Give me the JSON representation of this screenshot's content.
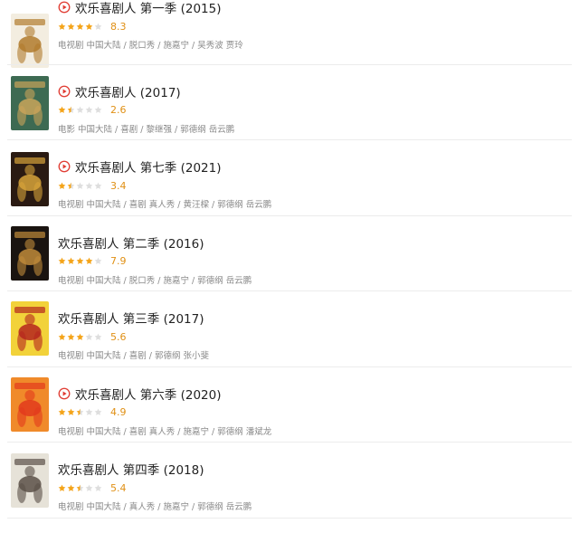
{
  "colors": {
    "star_full": "#f4a41a",
    "star_empty": "#dedede",
    "score": "#e09015",
    "play": "#e03a31",
    "title": "#222222",
    "meta": "#8a8a8a"
  },
  "items": [
    {
      "title": "欢乐喜剧人 第一季 (2015)",
      "has_play": true,
      "rating": 8.3,
      "rating_text": "8.3",
      "meta": "电视剧 中国大陆 / 脱口秀 / 施嘉宁 / 吴秀波 贾玲",
      "poster_icon": "show-poster-season1",
      "poster_colors": [
        "#f3ede0",
        "#b07a2c"
      ]
    },
    {
      "title": "欢乐喜剧人 (2017)",
      "has_play": true,
      "rating": 2.6,
      "rating_text": "2.6",
      "meta": "电影 中国大陆 / 喜剧 / 黎继强 / 郭德纲 岳云鹏",
      "poster_icon": "movie-poster-2017",
      "poster_colors": [
        "#3d6a52",
        "#c9a45a"
      ]
    },
    {
      "title": "欢乐喜剧人 第七季 (2021)",
      "has_play": true,
      "rating": 3.4,
      "rating_text": "3.4",
      "meta": "电视剧 中国大陆 / 喜剧 真人秀 / 黄汪樑 / 郭德纲 岳云鹏",
      "poster_icon": "show-poster-season7",
      "poster_colors": [
        "#2a1a12",
        "#d7a43b"
      ]
    },
    {
      "title": "欢乐喜剧人 第二季 (2016)",
      "has_play": false,
      "rating": 7.9,
      "rating_text": "7.9",
      "meta": "电视剧 中国大陆 / 脱口秀 / 施嘉宁 / 郭德纲 岳云鹏",
      "poster_icon": "show-poster-season2",
      "poster_colors": [
        "#1a1410",
        "#c08a3a"
      ]
    },
    {
      "title": "欢乐喜剧人 第三季 (2017)",
      "has_play": false,
      "rating": 5.6,
      "rating_text": "5.6",
      "meta": "电视剧 中国大陆 / 喜剧 / 郭德纲 张小斐",
      "poster_icon": "show-poster-season3",
      "poster_colors": [
        "#f2d23a",
        "#b5261e"
      ]
    },
    {
      "title": "欢乐喜剧人 第六季 (2020)",
      "has_play": true,
      "rating": 4.9,
      "rating_text": "4.9",
      "meta": "电视剧 中国大陆 / 喜剧 真人秀 / 施嘉宁 / 郭德纲 潘斌龙",
      "poster_icon": "show-poster-season6",
      "poster_colors": [
        "#f08a2a",
        "#e23a1c"
      ]
    },
    {
      "title": "欢乐喜剧人 第四季 (2018)",
      "has_play": false,
      "rating": 5.4,
      "rating_text": "5.4",
      "meta": "电视剧 中国大陆 / 真人秀 / 施嘉宁 / 郭德纲 岳云鹏",
      "poster_icon": "show-poster-season4",
      "poster_colors": [
        "#e6e2d8",
        "#5a5048"
      ]
    }
  ]
}
